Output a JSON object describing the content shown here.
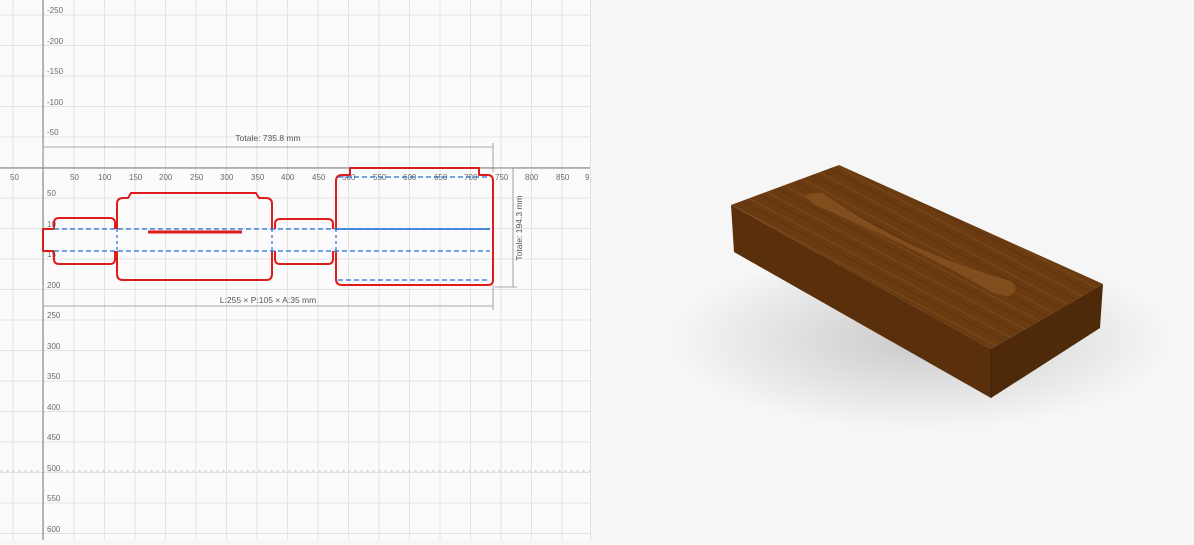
{
  "ruler": {
    "x_labels": [
      "50",
      "50",
      "100",
      "150",
      "200",
      "250",
      "300",
      "350",
      "400",
      "450",
      "500",
      "550",
      "600",
      "650",
      "700",
      "750",
      "800",
      "850",
      "9"
    ],
    "y_labels_top": [
      "-250",
      "-200",
      "-150",
      "-100",
      "-50"
    ],
    "y_labels_bottom": [
      "50",
      "10",
      "15",
      "200",
      "250",
      "300",
      "350",
      "400",
      "450",
      "500",
      "550",
      "600"
    ]
  },
  "dimensions": {
    "total_width": "Totale: 735.8 mm",
    "total_height": "Totale: 194.3 mm",
    "box_size": "L:255 × P:105 × A:35 mm"
  },
  "colors": {
    "cut_line": "#e01b1b",
    "fold_line": "#1f6fd6",
    "wood_top": "#6a3a10",
    "wood_front": "#4f2a0a",
    "wood_side": "#5a300c"
  },
  "preview": {
    "object": "wooden-box-3d"
  }
}
